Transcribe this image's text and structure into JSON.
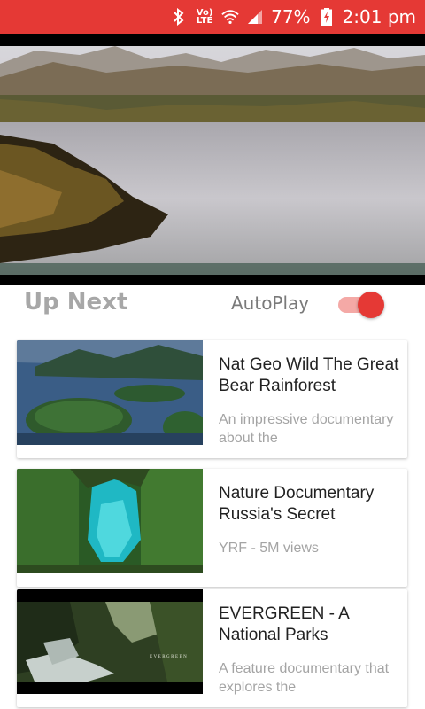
{
  "status_bar": {
    "volte_line1": "Vo)",
    "volte_line2": "LTE",
    "battery": "77%",
    "time": "2:01 pm",
    "color": "#e53935"
  },
  "player": {
    "scene": "mountain-lake-aerial"
  },
  "up_next": {
    "title": "Up Next",
    "autoplay_label": "AutoPlay",
    "autoplay_on": true,
    "accent": "#e53935"
  },
  "videos": [
    {
      "title": "Nat Geo Wild The Great Bear Rainforest",
      "subtitle": "An impressive documentary about the",
      "thumbnail": "island-lake-forest"
    },
    {
      "title": "Nature Documentary Russia's Secret",
      "subtitle": "YRF - 5M views",
      "thumbnail": "green-cave-turquoise-water"
    },
    {
      "title": "EVERGREEN - A National Parks",
      "subtitle": "A feature documentary that explores the",
      "thumbnail": "forest-waterfall",
      "thumbnail_caption": "EVERGREEN"
    }
  ]
}
